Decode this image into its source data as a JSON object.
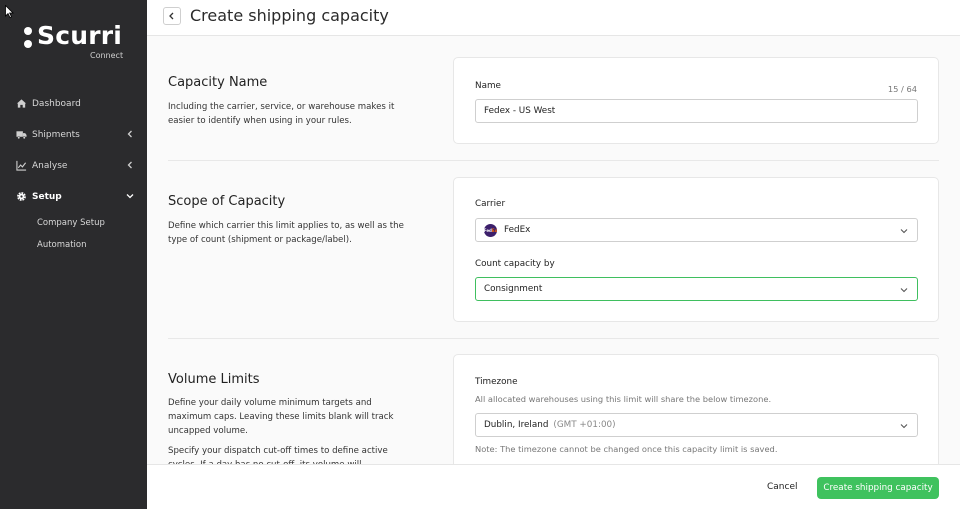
{
  "sidebar": {
    "logo_text": "Scurri",
    "logo_sub": "Connect",
    "items": [
      {
        "label": "Dashboard"
      },
      {
        "label": "Shipments"
      },
      {
        "label": "Analyse"
      },
      {
        "label": "Setup"
      }
    ],
    "sub_items": [
      {
        "label": "Company Setup"
      },
      {
        "label": "Automation"
      }
    ]
  },
  "header": {
    "title": "Create shipping capacity"
  },
  "sections": {
    "capacity_name": {
      "title": "Capacity Name",
      "description": "Including the carrier, service, or warehouse makes it easier to identify when using in your rules.",
      "field_label": "Name",
      "counter": "15 / 64",
      "value": "Fedex - US West"
    },
    "scope": {
      "title": "Scope of Capacity",
      "description": "Define which carrier this limit applies to, as well as the type of count (shipment or package/label).",
      "carrier_label": "Carrier",
      "carrier_value": "FedEx",
      "count_label": "Count capacity by",
      "count_value": "Consignment"
    },
    "volume": {
      "title": "Volume Limits",
      "description": "Define your daily volume minimum targets and maximum caps. Leaving these limits blank will track uncapped volume.",
      "description2": "Specify your dispatch cut-off times to define active cycles. If a day has no cut-off, its volume will",
      "timezone_label": "Timezone",
      "timezone_hint": "All allocated warehouses using this limit will share the below timezone.",
      "timezone_value": "Dublin, Ireland",
      "timezone_offset": "(GMT +01:00)",
      "timezone_note": "Note: The timezone cannot be changed once this capacity limit is saved."
    }
  },
  "footer": {
    "cancel_label": "Cancel",
    "create_label": "Create shipping capacity"
  },
  "colors": {
    "sidebar_bg": "#2b2b2d",
    "accent_green": "#3fc25e",
    "fedex_purple": "#3c1f6b",
    "fedex_orange": "#ff6a00"
  },
  "icons": {
    "back": "chevron-left-icon",
    "dashboard": "home-icon",
    "shipments": "truck-icon",
    "analyse": "line-chart-icon",
    "setup": "gear-icon",
    "dropdown": "chevron-down-icon"
  }
}
